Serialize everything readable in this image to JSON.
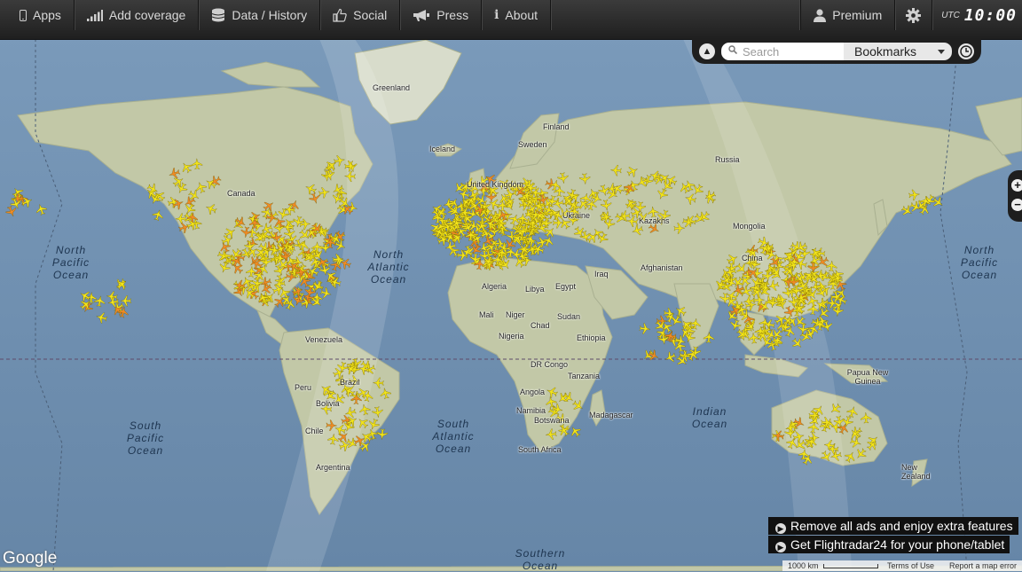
{
  "nav": {
    "items": [
      {
        "label": "Apps",
        "icon": "phone-icon"
      },
      {
        "label": "Add coverage",
        "icon": "signal-icon"
      },
      {
        "label": "Data / History",
        "icon": "database-icon"
      },
      {
        "label": "Social",
        "icon": "thumbs-up-icon"
      },
      {
        "label": "Press",
        "icon": "megaphone-icon"
      },
      {
        "label": "About",
        "icon": "info-icon"
      }
    ],
    "premium_label": "Premium",
    "utc_label": "UTC",
    "time": "10:00"
  },
  "search": {
    "placeholder": "Search",
    "bookmarks_label": "Bookmarks"
  },
  "map": {
    "countries": [
      "Greenland",
      "Finland",
      "Sweden",
      "Iceland",
      "Russia",
      "United Kingdom",
      "Canada",
      "Kazakhs",
      "Ukraine",
      "Mongolia",
      "China",
      "Afghanistan",
      "Algeria",
      "Libya",
      "Egypt",
      "Iraq",
      "Mali",
      "Niger",
      "Chad",
      "Sudan",
      "Nigeria",
      "Ethiopia",
      "Venezuela",
      "DR Congo",
      "Tanzania",
      "Brazil",
      "Peru",
      "Bolivia",
      "Angola",
      "Namibia",
      "Botswana",
      "Madagascar",
      "Chile",
      "Argentina",
      "South Africa",
      "Papua New Guinea",
      "New Zealand"
    ],
    "oceans": [
      "North Pacific Ocean",
      "North Atlantic Ocean",
      "South Pacific Ocean",
      "South Atlantic Ocean",
      "Indian Ocean",
      "Southern Ocean",
      "North Pacific Ocean"
    ],
    "attribution": "Google",
    "scale": "1000 km",
    "terms": "Terms of Use",
    "report": "Report a map error"
  },
  "promo": {
    "remove_ads": "Remove all ads and enjoy extra features",
    "get_app": "Get Flightradar24 for your phone/tablet"
  },
  "colors": {
    "aircraft": "#f2e41a",
    "aircraft_alt": "#f08a24",
    "navbar": "#2a2a2a"
  }
}
